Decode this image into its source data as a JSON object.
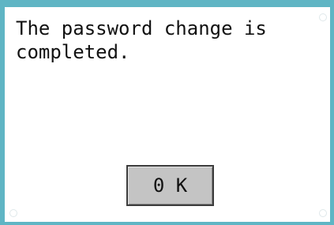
{
  "dialog": {
    "message": "The password change is\ncompleted.",
    "ok_label": "0 K"
  },
  "colors": {
    "frame": "#5fb5c4",
    "background": "#ffffff",
    "button": "#c4c4c4"
  }
}
